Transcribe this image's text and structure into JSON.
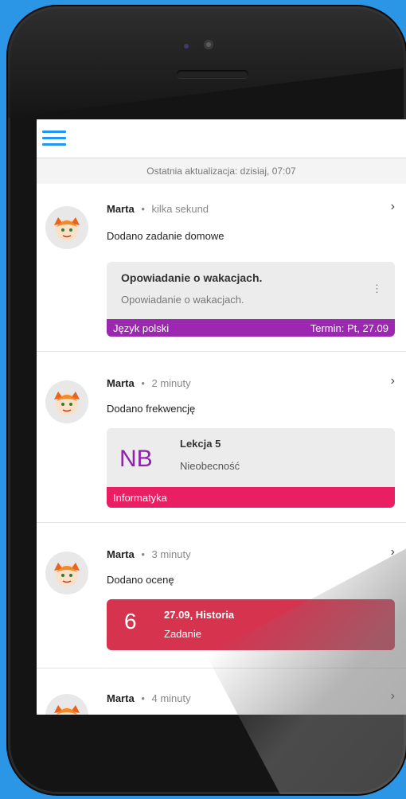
{
  "colors": {
    "background": "#2b95e6",
    "menu_accent": "#2196f3",
    "polish": "#9c27b0",
    "informatics": "#e91e63",
    "grade_card": "#d6334f",
    "attendance_code": "#8e24aa"
  },
  "header": {
    "menu_icon": "hamburger-menu-icon"
  },
  "update_text": "Ostatnia aktualizacja: dzisiaj, 07:07",
  "feed": [
    {
      "author": "Marta",
      "time": "kilka sekund",
      "action": "Dodano zadanie domowe",
      "homework": {
        "title": "Opowiadanie o wakacjach.",
        "description": "Opowiadanie o wakacjach.",
        "subject": "Język polski",
        "deadline": "Termin: Pt, 27.09"
      }
    },
    {
      "author": "Marta",
      "time": "2 minuty",
      "action": "Dodano frekwencję",
      "attendance": {
        "code": "NB",
        "lesson": "Lekcja 5",
        "status": "Nieobecność",
        "subject": "Informatyka"
      }
    },
    {
      "author": "Marta",
      "time": "3 minuty",
      "action": "Dodano ocenę",
      "grade": {
        "value": "6",
        "title": "27.09, Historia",
        "category": "Zadanie"
      }
    },
    {
      "author": "Marta",
      "time": "4 minuty"
    }
  ],
  "icons": {
    "chevron": "chevron-right-icon",
    "more": "more-vertical-icon",
    "avatar": "girl-avatar-icon"
  }
}
